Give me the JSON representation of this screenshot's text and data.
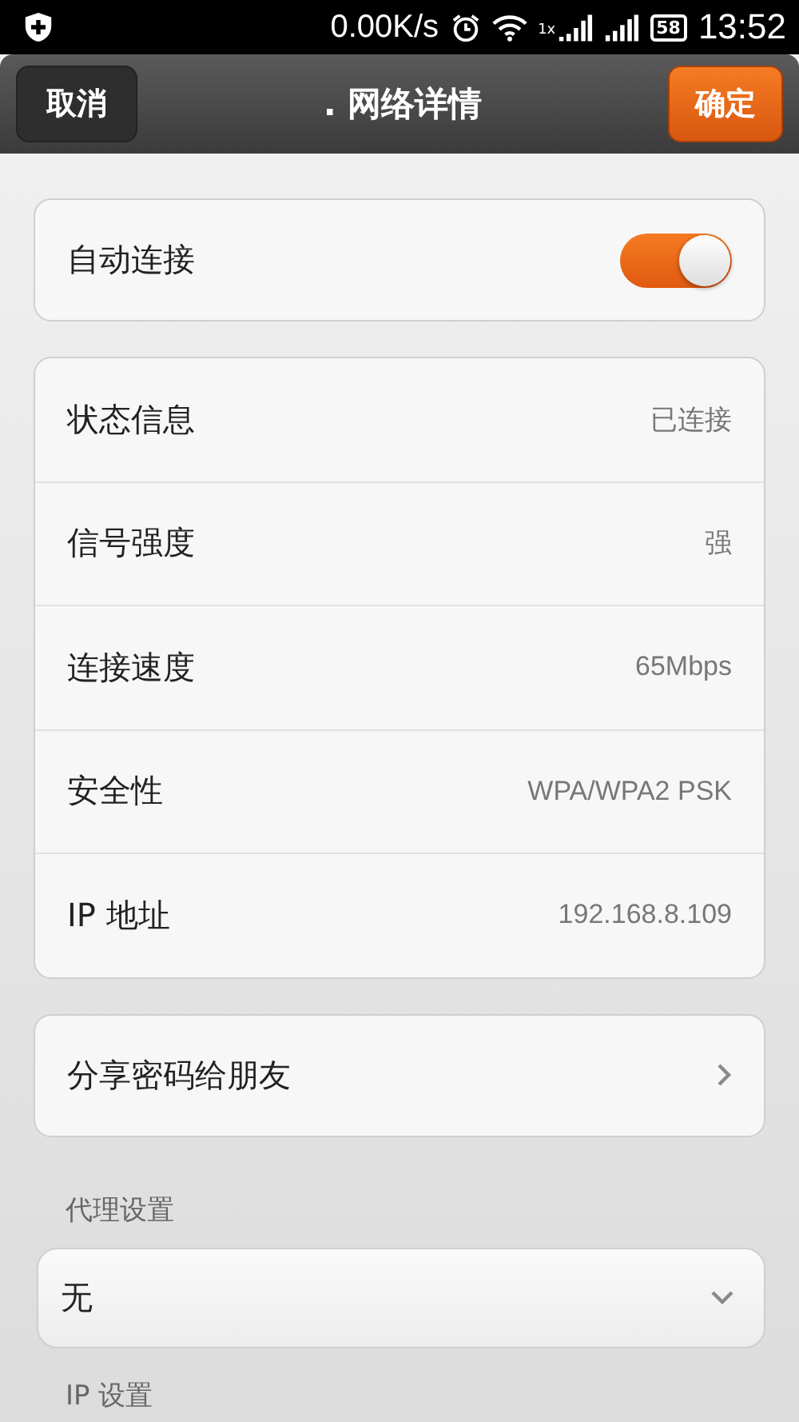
{
  "status_bar": {
    "speed": "0.00K/s",
    "network_type": "1x",
    "battery": "58",
    "time": "13:52"
  },
  "header": {
    "cancel": "取消",
    "title": ". 网络详情",
    "confirm": "确定"
  },
  "auto_connect": {
    "label": "自动连接",
    "on": true
  },
  "details": [
    {
      "label": "状态信息",
      "value": "已连接"
    },
    {
      "label": "信号强度",
      "value": "强"
    },
    {
      "label": "连接速度",
      "value": "65Mbps"
    },
    {
      "label": "安全性",
      "value": "WPA/WPA2 PSK"
    },
    {
      "label": "IP 地址",
      "value": "192.168.8.109"
    }
  ],
  "share": {
    "label": "分享密码给朋友"
  },
  "proxy": {
    "label": "代理设置",
    "value": "无"
  },
  "ip_settings": {
    "label": "IP 设置"
  }
}
